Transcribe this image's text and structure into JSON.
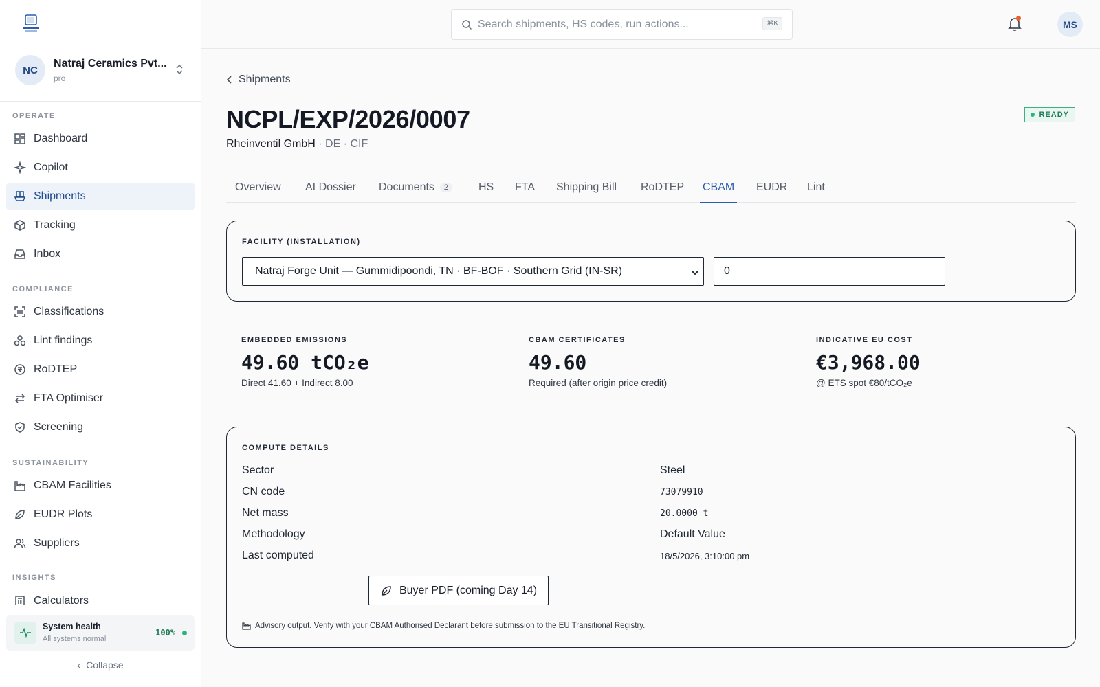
{
  "org": {
    "initials": "NC",
    "name": "Natraj Ceramics Pvt...",
    "plan": "pro"
  },
  "sidebar": {
    "groups": [
      {
        "label": "OPERATE"
      },
      {
        "label": "COMPLIANCE"
      },
      {
        "label": "SUSTAINABILITY"
      },
      {
        "label": "INSIGHTS"
      }
    ],
    "items": [
      {
        "label": "Dashboard",
        "icon": "dashboard-icon"
      },
      {
        "label": "Copilot",
        "icon": "sparkle-icon"
      },
      {
        "label": "Shipments",
        "icon": "ship-icon",
        "active": true
      },
      {
        "label": "Tracking",
        "icon": "box-icon"
      },
      {
        "label": "Inbox",
        "icon": "inbox-icon"
      },
      {
        "label": "Classifications",
        "icon": "scan-icon"
      },
      {
        "label": "Lint findings",
        "icon": "hub-icon"
      },
      {
        "label": "RoDTEP",
        "icon": "currency-icon"
      },
      {
        "label": "FTA Optimiser",
        "icon": "arrows-icon"
      },
      {
        "label": "Screening",
        "icon": "shield-icon"
      },
      {
        "label": "CBAM Facilities",
        "icon": "factory-icon"
      },
      {
        "label": "EUDR Plots",
        "icon": "leaf-icon"
      },
      {
        "label": "Suppliers",
        "icon": "users-icon"
      },
      {
        "label": "Calculators",
        "icon": "calculator-icon"
      }
    ],
    "health": {
      "title": "System health",
      "status": "All systems normal",
      "percent": "100%"
    },
    "collapse_label": "Collapse"
  },
  "topbar": {
    "search_placeholder": "Search shipments, HS codes, run actions...",
    "shortcut": "⌘K",
    "user_initials": "MS"
  },
  "page": {
    "breadcrumb": "Shipments",
    "title": "NCPL/EXP/2026/0007",
    "buyer": "Rheinventil GmbH",
    "meta": " · DE · CIF",
    "status": "READY",
    "tabs": [
      {
        "label": "Overview"
      },
      {
        "label": "AI Dossier"
      },
      {
        "label": "Documents",
        "count": "2"
      },
      {
        "label": "HS"
      },
      {
        "label": "FTA"
      },
      {
        "label": "Shipping Bill"
      },
      {
        "label": "RoDTEP"
      },
      {
        "label": "CBAM",
        "active": true
      },
      {
        "label": "EUDR"
      },
      {
        "label": "Lint"
      }
    ]
  },
  "facility": {
    "label": "FACILITY (INSTALLATION)",
    "selected": "Natraj Forge Unit — Gummidipoondi, TN · BF-BOF · Southern Grid (IN-SR)",
    "value": "0"
  },
  "metrics": [
    {
      "label": "EMBEDDED EMISSIONS",
      "value": "49.60 tCO₂e",
      "sub": "Direct 41.60 + Indirect 8.00"
    },
    {
      "label": "CBAM CERTIFICATES",
      "value": "49.60",
      "sub": "Required (after origin price credit)"
    },
    {
      "label": "INDICATIVE EU COST",
      "value": "€3,968.00",
      "sub": "@ ETS spot €80/tCO₂e"
    }
  ],
  "compute": {
    "label": "COMPUTE DETAILS",
    "rows": [
      {
        "key": "Sector",
        "value": "Steel"
      },
      {
        "key": "CN code",
        "value": "73079910"
      },
      {
        "key": "Net mass",
        "value": "20.0000 t"
      },
      {
        "key": "Methodology",
        "value": "Default Value"
      },
      {
        "key": "Last computed",
        "value": "18/5/2026, 3:10:00 pm"
      }
    ],
    "pdf_button": "Buyer PDF (coming Day 14)",
    "advisory": "Advisory output. Verify with your CBAM Authorised Declarant before submission to the EU Transitional Registry."
  },
  "colors": {
    "accent": "#2a5cb0",
    "active_bg": "#eef3fa",
    "success": "#2bb37c",
    "notification": "#e9602b"
  }
}
